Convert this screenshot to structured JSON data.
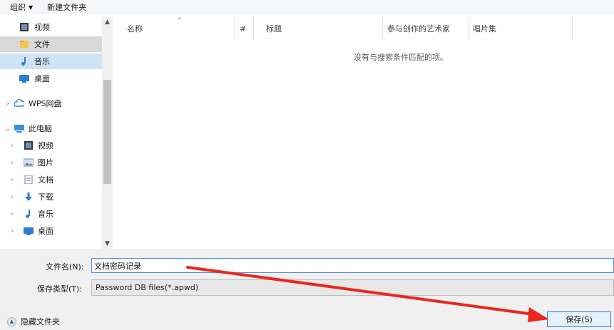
{
  "toolbar": {
    "organize": "组织",
    "new_folder": "新建文件夹"
  },
  "sidebar": {
    "items": [
      {
        "label": "视频"
      },
      {
        "label": "文件"
      },
      {
        "label": "音乐"
      },
      {
        "label": "桌面"
      },
      {
        "label": "WPS网盘"
      },
      {
        "label": "此电脑"
      },
      {
        "label": "视频"
      },
      {
        "label": "图片"
      },
      {
        "label": "文档"
      },
      {
        "label": "下载"
      },
      {
        "label": "音乐"
      },
      {
        "label": "桌面"
      }
    ]
  },
  "columns": {
    "name": "名称",
    "number": "#",
    "title": "标题",
    "artist": "参与创作的艺术家",
    "album": "唱片集"
  },
  "empty_message": "没有与搜索条件匹配的项。",
  "form": {
    "filename_label": "文件名(N):",
    "filename_value": "文档密码记录",
    "type_label": "保存类型(T):",
    "type_value": "Password DB files(*.apwd)",
    "hide_folders": "隐藏文件夹",
    "save_button": "保存(S)"
  },
  "colors": {
    "selection": "#cfe3f7",
    "accent": "#2a7fd4",
    "annotation_arrow": "#e8271f"
  }
}
